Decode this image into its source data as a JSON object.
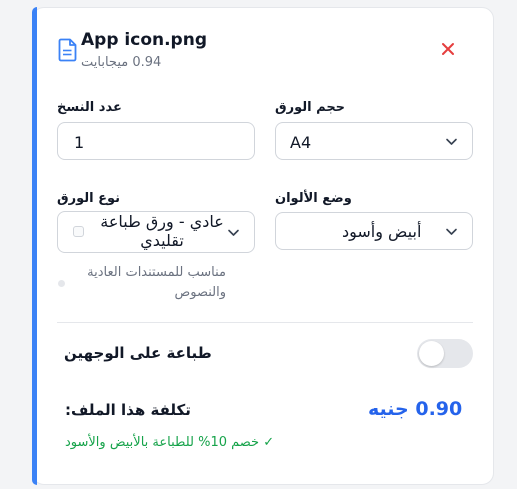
{
  "file": {
    "icon": "document-icon",
    "name": "App icon.png",
    "size": "0.94 ميجابايت",
    "close_icon": "close-icon"
  },
  "copies": {
    "label": "عدد النسخ",
    "value": "1"
  },
  "paper_size": {
    "label": "حجم الورق",
    "value": "A4"
  },
  "paper_type": {
    "label": "نوع الورق",
    "value": "عادي - ورق طباعة تقليدي",
    "hint": "مناسب للمستندات العادية والنصوص"
  },
  "color_mode": {
    "label": "وضع الألوان",
    "value": "أبيض وأسود"
  },
  "duplex": {
    "label": "طباعة على الوجهين",
    "enabled": false
  },
  "cost": {
    "label": "تكلفة هذا الملف:",
    "value": "0.90 جنيه",
    "discount": "✓ خصم 10% للطباعة بالأبيض والأسود"
  },
  "colors": {
    "accent": "#3b82f6",
    "price": "#2563eb",
    "discount": "#16a34a",
    "close": "#e53e3e"
  }
}
